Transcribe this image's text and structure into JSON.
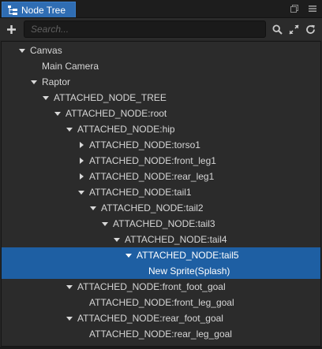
{
  "panel": {
    "tab_title": "Node Tree",
    "tab_icon": "node-tree-icon",
    "window_buttons": [
      "restore-icon",
      "menu-icon"
    ]
  },
  "toolbar": {
    "add_icon": "plus-icon",
    "search_placeholder": "Search...",
    "search_value": "",
    "buttons": [
      "search-icon",
      "expand-icon",
      "refresh-icon"
    ]
  },
  "colors": {
    "selection": "#1e5fa3",
    "tab_active": "#2f6db3",
    "background": "#2b2b2b"
  },
  "tree": {
    "nodes": [
      {
        "label": "Canvas",
        "depth": 0,
        "toggle": "expanded",
        "selected": false
      },
      {
        "label": "Main Camera",
        "depth": 1,
        "toggle": "none",
        "selected": false
      },
      {
        "label": "Raptor",
        "depth": 1,
        "toggle": "expanded",
        "selected": false
      },
      {
        "label": "ATTACHED_NODE_TREE",
        "depth": 2,
        "toggle": "expanded",
        "selected": false
      },
      {
        "label": "ATTACHED_NODE:root",
        "depth": 3,
        "toggle": "expanded",
        "selected": false
      },
      {
        "label": "ATTACHED_NODE:hip",
        "depth": 4,
        "toggle": "expanded",
        "selected": false
      },
      {
        "label": "ATTACHED_NODE:torso1",
        "depth": 5,
        "toggle": "collapsed",
        "selected": false
      },
      {
        "label": "ATTACHED_NODE:front_leg1",
        "depth": 5,
        "toggle": "collapsed",
        "selected": false
      },
      {
        "label": "ATTACHED_NODE:rear_leg1",
        "depth": 5,
        "toggle": "collapsed",
        "selected": false
      },
      {
        "label": "ATTACHED_NODE:tail1",
        "depth": 5,
        "toggle": "expanded",
        "selected": false
      },
      {
        "label": "ATTACHED_NODE:tail2",
        "depth": 6,
        "toggle": "expanded",
        "selected": false
      },
      {
        "label": "ATTACHED_NODE:tail3",
        "depth": 7,
        "toggle": "expanded",
        "selected": false
      },
      {
        "label": "ATTACHED_NODE:tail4",
        "depth": 8,
        "toggle": "expanded",
        "selected": false
      },
      {
        "label": "ATTACHED_NODE:tail5",
        "depth": 9,
        "toggle": "expanded",
        "selected": true
      },
      {
        "label": "New Sprite(Splash)",
        "depth": 10,
        "toggle": "none",
        "selected": true
      },
      {
        "label": "ATTACHED_NODE:front_foot_goal",
        "depth": 4,
        "toggle": "expanded",
        "selected": false
      },
      {
        "label": "ATTACHED_NODE:front_leg_goal",
        "depth": 5,
        "toggle": "none",
        "selected": false
      },
      {
        "label": "ATTACHED_NODE:rear_foot_goal",
        "depth": 4,
        "toggle": "expanded",
        "selected": false
      },
      {
        "label": "ATTACHED_NODE:rear_leg_goal",
        "depth": 5,
        "toggle": "none",
        "selected": false
      }
    ]
  }
}
